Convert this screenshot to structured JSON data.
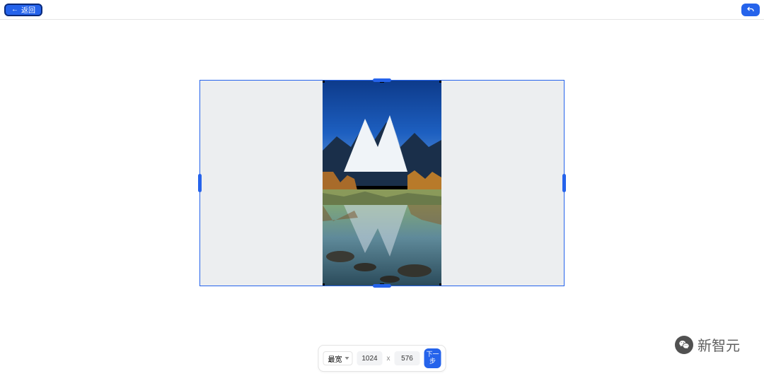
{
  "header": {
    "back_label": "返回"
  },
  "footer": {
    "aspect_label": "最宽",
    "width": "1024",
    "height": "576",
    "separator": "x",
    "next_label": "下一步"
  },
  "watermark": {
    "text": "新智元"
  }
}
